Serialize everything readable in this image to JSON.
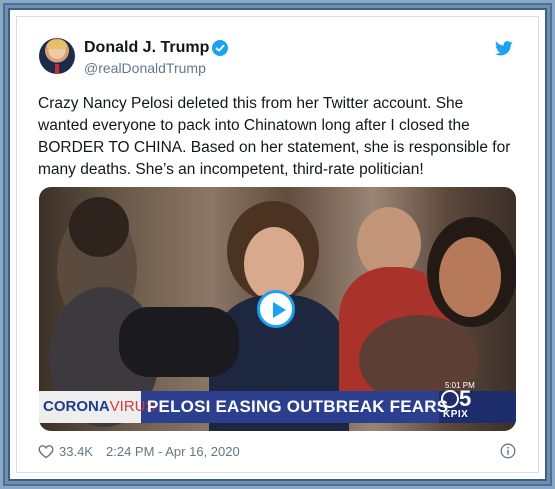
{
  "tweet": {
    "author_name": "Donald J. Trump",
    "handle": "@realDonaldTrump",
    "text": "Crazy Nancy Pelosi deleted this from her Twitter account. She wanted everyone to pack into Chinatown long after I closed the BORDER TO CHINA. Based on her statement, she is responsible for many deaths. She’s an incompetent, third-rate politician!",
    "likes": "33.4K",
    "timestamp": "2:24 PM - Apr 16, 2020"
  },
  "video": {
    "banner_left_main": "CORONA",
    "banner_left_suffix": "VIRUS",
    "headline": "PELOSI EASING OUTBREAK FEARS",
    "clock": "5:01 PM",
    "station_number": "5",
    "station_call": "KPIX"
  },
  "icons": {
    "avatar": "profile-photo",
    "verified": "verified-badge-icon",
    "brand": "twitter-bird-icon",
    "like": "heart-icon",
    "info": "info-icon",
    "play": "play-icon"
  },
  "colors": {
    "accent": "#1da1f2",
    "frame": "#4d6f93",
    "text": "#14171a",
    "muted": "#657786",
    "banner_blue": "#2c3f8f"
  }
}
